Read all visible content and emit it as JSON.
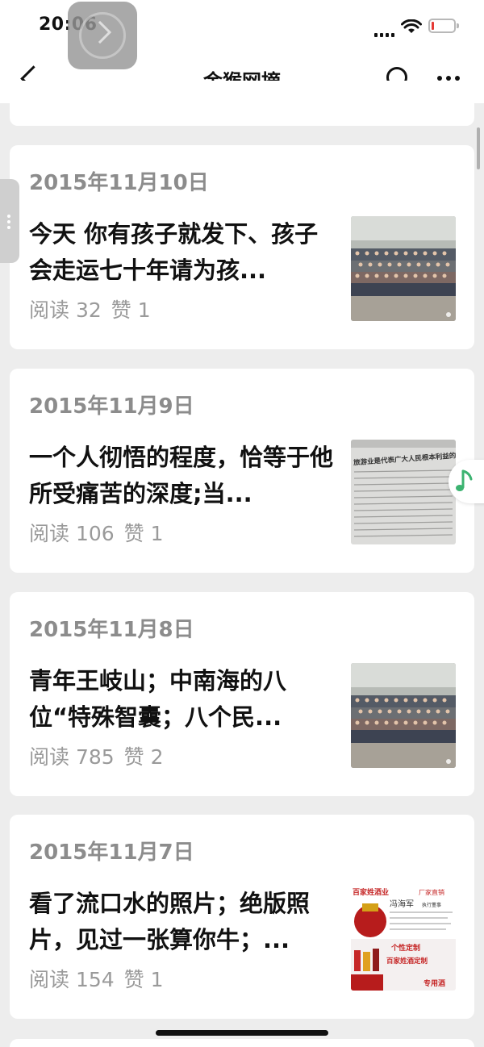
{
  "status_bar": {
    "time": "20:06"
  },
  "navbar": {
    "title": "金猴网摘"
  },
  "articles": [
    {
      "date": "2015年11月10日",
      "title": "今天 你有孩子就发下、孩子会走运七十年请为孩...",
      "reads": "阅读 32",
      "likes": "赞 1",
      "thumbnail": "group-photo"
    },
    {
      "date": "2015年11月9日",
      "title": "一个人彻悟的程度，恰等于他所受痛苦的深度;当...",
      "reads": "阅读 106",
      "likes": "赞 1",
      "thumbnail": "newspaper",
      "thumbnail_caption": "旅游业是代表广大人民根本利益的"
    },
    {
      "date": "2015年11月8日",
      "title": "青年王岐山；中南海的八位“特殊智囊；八个民...",
      "reads": "阅读 785",
      "likes": "赞 2",
      "thumbnail": "group-photo"
    },
    {
      "date": "2015年11月7日",
      "title": "看了流口水的照片；绝版照片，见过一张算你牛；...",
      "reads": "阅读 154",
      "likes": "赞 1",
      "thumbnail": "liquor-ad",
      "ad": {
        "brand": "百家姓酒业",
        "tag": "厂家直销",
        "name": "冯海军",
        "role": "执行董事",
        "line1": "个性定制",
        "line2": "百家姓酒定制",
        "line3": "专用酒"
      }
    }
  ],
  "icons": {
    "back": "chevron-left-icon",
    "search": "search-icon",
    "more": "more-dots-icon",
    "music": "music-note-icon"
  },
  "colors": {
    "music_accent": "#3cb371",
    "battery_low": "#e53935"
  }
}
